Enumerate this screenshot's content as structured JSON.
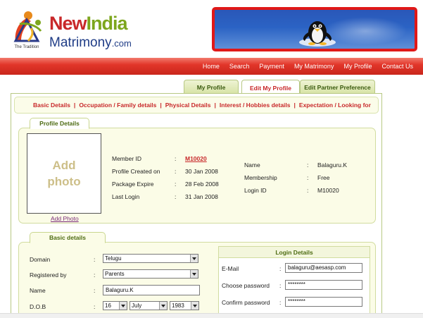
{
  "header": {
    "brand_new": "New",
    "brand_india": "India",
    "brand_matrimony": "Matrimony",
    "brand_domain": ".com",
    "tagline": "The Tradition"
  },
  "nav": {
    "items": [
      "Home",
      "Search",
      "Payment",
      "My Matrimony",
      "My Profile",
      "Contact Us"
    ]
  },
  "tabs": [
    "My Profile",
    "Edit My Profile",
    "Edit Partner Preference"
  ],
  "subnav": [
    "Basic Details",
    "Occupation / Family details",
    "Physical Details",
    "Interest / Hobbies details",
    "Expectation / Looking for"
  ],
  "profile_details": {
    "tab_label": "Profile Details",
    "photo_text": "Add photo",
    "add_photo_link": "Add Photo",
    "left": [
      {
        "label": "Member ID",
        "value": "M10020"
      },
      {
        "label": "Profile Created on",
        "value": "30 Jan 2008"
      },
      {
        "label": "Package Expire",
        "value": "28 Feb 2008"
      },
      {
        "label": "Last Login",
        "value": "31 Jan 2008"
      }
    ],
    "right": [
      {
        "label": "Name",
        "value": "Balaguru.K"
      },
      {
        "label": "Membership",
        "value": "Free"
      },
      {
        "label": "Login ID",
        "value": "M10020"
      }
    ],
    "colon": ":"
  },
  "basic_details": {
    "tab_label": "Basic details",
    "domain": {
      "label": "Domain",
      "value": "Telugu"
    },
    "registered_by": {
      "label": "Registered by",
      "value": "Parents"
    },
    "name": {
      "label": "Name",
      "value": "Balaguru.K"
    },
    "dob": {
      "label": "D.O.B",
      "day": "16",
      "month": "July",
      "year": "1983"
    }
  },
  "login_details": {
    "title": "Login Details",
    "email": {
      "label": "E-Mail",
      "value": "balaguru@aesasp.com"
    },
    "password": {
      "label": "Choose password",
      "value": "********"
    },
    "confirm": {
      "label": "Confirm password",
      "value": "********"
    }
  },
  "colors": {
    "accent_red": "#c8282a",
    "nav_red": "#e2362a",
    "green": "#7da61d",
    "brand_blue": "#1f3c86"
  }
}
